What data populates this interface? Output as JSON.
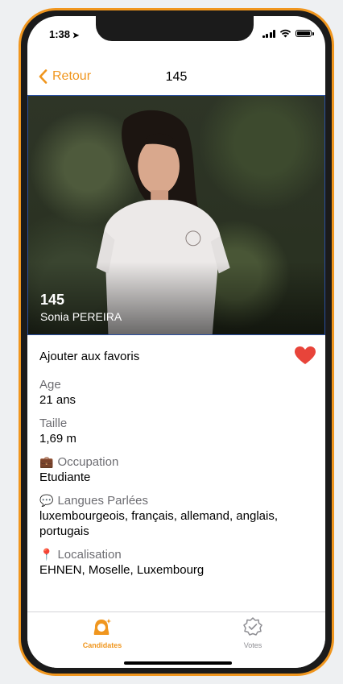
{
  "status_bar": {
    "time": "1:38"
  },
  "navbar": {
    "back_label": "Retour",
    "title": "145"
  },
  "candidate": {
    "number": "145",
    "name": "Sonia PEREIRA"
  },
  "favorites": {
    "label": "Ajouter aux favoris",
    "favorited": true
  },
  "fields": {
    "age": {
      "label": "Age",
      "value": "21 ans"
    },
    "height": {
      "label": "Taille",
      "value": "1,69 m"
    },
    "occupation": {
      "icon": "briefcase-icon",
      "label": "Occupation",
      "value": "Etudiante"
    },
    "languages": {
      "icon": "speech-bubble-icon",
      "label": "Langues Parlées",
      "value": "luxembourgeois, français, allemand, anglais, portugais"
    },
    "location": {
      "icon": "pin-icon",
      "label": "Localisation",
      "value": "EHNEN, Moselle, Luxembourg"
    }
  },
  "tabs": [
    {
      "label": "Candidates",
      "icon": "candidate-icon",
      "active": true
    },
    {
      "label": "Votes",
      "icon": "vote-badge-icon",
      "active": false
    }
  ],
  "colors": {
    "accent": "#f0961e",
    "heart": "#e8443a",
    "inactive": "#8e8e93"
  }
}
